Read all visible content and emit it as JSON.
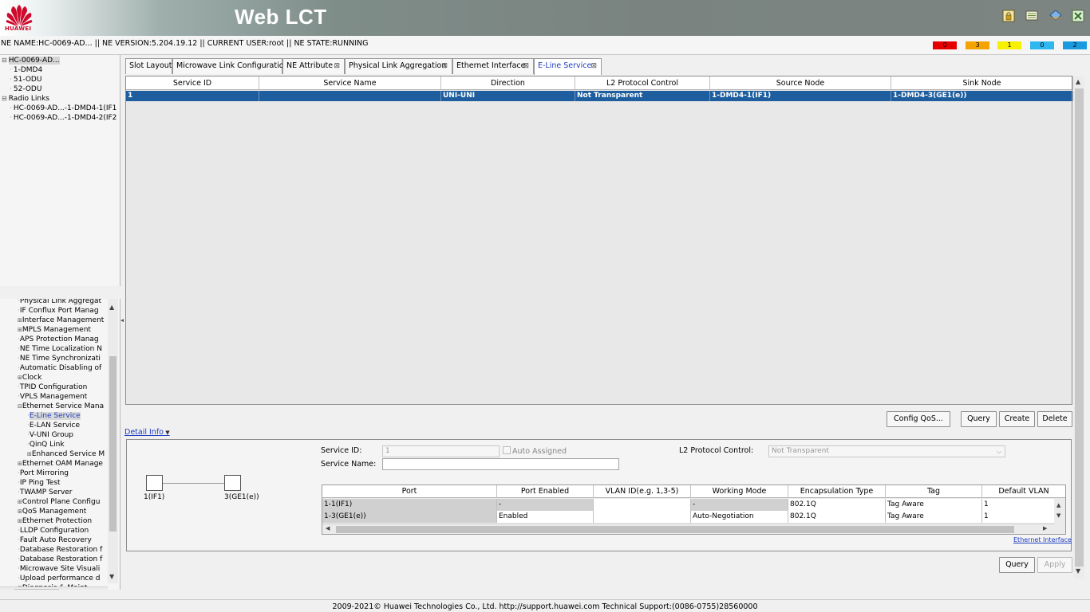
{
  "header": {
    "logo_text": "HUAWEI",
    "app_title": "Web LCT",
    "icons": [
      "lock-icon",
      "monitor-icon",
      "network-icon",
      "close-icon"
    ]
  },
  "infobar": {
    "ne_info": "NE NAME:HC-0069-AD... || NE VERSION:5.204.19.12 || CURRENT USER:root || NE STATE:RUNNING",
    "alarms": [
      {
        "name": "critical",
        "count": "0",
        "color": "#e50000"
      },
      {
        "name": "major",
        "count": "3",
        "color": "#f5a300"
      },
      {
        "name": "minor",
        "count": "1",
        "color": "#f7f000"
      },
      {
        "name": "warning",
        "count": "0",
        "color": "#2fb7f0"
      },
      {
        "name": "info",
        "count": "2",
        "color": "#1a9be0"
      }
    ]
  },
  "ne_tree": {
    "items": [
      {
        "label": "HC-0069-AD...",
        "expander": "-",
        "level": 0
      },
      {
        "label": "1-DMD4",
        "expander": "",
        "level": 1
      },
      {
        "label": "51-ODU",
        "expander": "",
        "level": 1
      },
      {
        "label": "52-ODU",
        "expander": "",
        "level": 1
      },
      {
        "label": "Radio Links",
        "expander": "-",
        "level": 0
      },
      {
        "label": "HC-0069-AD...-1-DMD4-1(IF1",
        "expander": "",
        "level": 1
      },
      {
        "label": "HC-0069-AD...-1-DMD4-2(IF2",
        "expander": "",
        "level": 1
      }
    ]
  },
  "function_tree": {
    "items": [
      {
        "label": "Physical Link Aggregat",
        "expander": "",
        "level": 1
      },
      {
        "label": "IF Conflux Port Manag",
        "expander": "",
        "level": 1
      },
      {
        "label": "Interface Management",
        "expander": "+",
        "level": 1
      },
      {
        "label": "MPLS Management",
        "expander": "+",
        "level": 1
      },
      {
        "label": "APS Protection Manag",
        "expander": "",
        "level": 1
      },
      {
        "label": "NE Time Localization N",
        "expander": "",
        "level": 1
      },
      {
        "label": "NE Time Synchronizati",
        "expander": "",
        "level": 1
      },
      {
        "label": "Automatic Disabling of",
        "expander": "",
        "level": 1
      },
      {
        "label": "Clock",
        "expander": "+",
        "level": 1
      },
      {
        "label": "TPID Configuration",
        "expander": "",
        "level": 1
      },
      {
        "label": "VPLS Management",
        "expander": "",
        "level": 1
      },
      {
        "label": "Ethernet Service Mana",
        "expander": "-",
        "level": 1
      },
      {
        "label": "E-Line Service",
        "expander": "",
        "level": 2,
        "selected": true
      },
      {
        "label": "E-LAN Service",
        "expander": "",
        "level": 2
      },
      {
        "label": "V-UNI Group",
        "expander": "",
        "level": 2
      },
      {
        "label": "QinQ Link",
        "expander": "",
        "level": 2
      },
      {
        "label": "Enhanced Service M",
        "expander": "+",
        "level": 2
      },
      {
        "label": "Ethernet OAM Manage",
        "expander": "+",
        "level": 1
      },
      {
        "label": "Port Mirroring",
        "expander": "",
        "level": 1
      },
      {
        "label": "IP Ping Test",
        "expander": "",
        "level": 1
      },
      {
        "label": "TWAMP Server",
        "expander": "",
        "level": 1
      },
      {
        "label": "Control Plane Configu",
        "expander": "+",
        "level": 1
      },
      {
        "label": "QoS Management",
        "expander": "+",
        "level": 1
      },
      {
        "label": "Ethernet Protection",
        "expander": "+",
        "level": 1
      },
      {
        "label": "LLDP Configuration",
        "expander": "",
        "level": 1
      },
      {
        "label": "Fault Auto Recovery",
        "expander": "",
        "level": 1
      },
      {
        "label": "Database Restoration f",
        "expander": "",
        "level": 1
      },
      {
        "label": "Database Restoration f",
        "expander": "",
        "level": 1
      },
      {
        "label": "Microwave Site Visuali",
        "expander": "",
        "level": 1
      },
      {
        "label": "Upload performance d",
        "expander": "",
        "level": 1
      },
      {
        "label": "Diagnosis & Maint",
        "expander": "+",
        "level": 0
      }
    ]
  },
  "tabs": [
    {
      "label": "Slot Layout",
      "closable": false,
      "active": false
    },
    {
      "label": "Microwave Link Configuration",
      "closable": false,
      "active": false
    },
    {
      "label": "NE Attribute",
      "closable": true,
      "active": false
    },
    {
      "label": "Physical Link Aggregation",
      "closable": true,
      "active": false
    },
    {
      "label": "Ethernet Interface",
      "closable": true,
      "active": false
    },
    {
      "label": "E-Line Service",
      "closable": true,
      "active": true
    }
  ],
  "service_table": {
    "columns": [
      "Service ID",
      "Service Name",
      "Direction",
      "L2 Protocol Control",
      "Source Node",
      "Sink Node"
    ],
    "rows": [
      [
        "1",
        "",
        "UNI-UNI",
        "Not Transparent",
        "1-DMD4-1(IF1)",
        "1-DMD4-3(GE1(e))"
      ]
    ]
  },
  "main_buttons": {
    "config_qos": "Config QoS...",
    "query": "Query",
    "create": "Create",
    "delete": "Delete"
  },
  "detail": {
    "link_label": "Detail Info",
    "service_id_label": "Service ID:",
    "service_id_value": "1",
    "auto_assigned_label": "Auto Assigned",
    "service_name_label": "Service Name:",
    "service_name_value": "",
    "l2_label": "L2 Protocol Control:",
    "l2_value": "Not Transparent",
    "diagram": {
      "left_port": "1(IF1)",
      "right_port": "3(GE1(e))"
    },
    "port_table": {
      "columns": [
        "Port",
        "Port Enabled",
        "VLAN ID(e.g. 1,3-5)",
        "Working Mode",
        "Encapsulation Type",
        "Tag",
        "Default VLAN"
      ],
      "rows": [
        [
          "1-1(IF1)",
          "-",
          "",
          "-",
          "802.1Q",
          "Tag Aware",
          "1"
        ],
        [
          "1-3(GE1(e))",
          "Enabled",
          "",
          "Auto-Negotiation",
          "802.1Q",
          "Tag Aware",
          "1"
        ]
      ]
    },
    "ethernet_interface_link": "Ethernet Interface"
  },
  "bottom_buttons": {
    "query": "Query",
    "apply": "Apply"
  },
  "footer": {
    "text": "2009-2021© Huawei Technologies Co., Ltd. http://support.huawei.com Technical Support:(0086-0755)28560000"
  }
}
